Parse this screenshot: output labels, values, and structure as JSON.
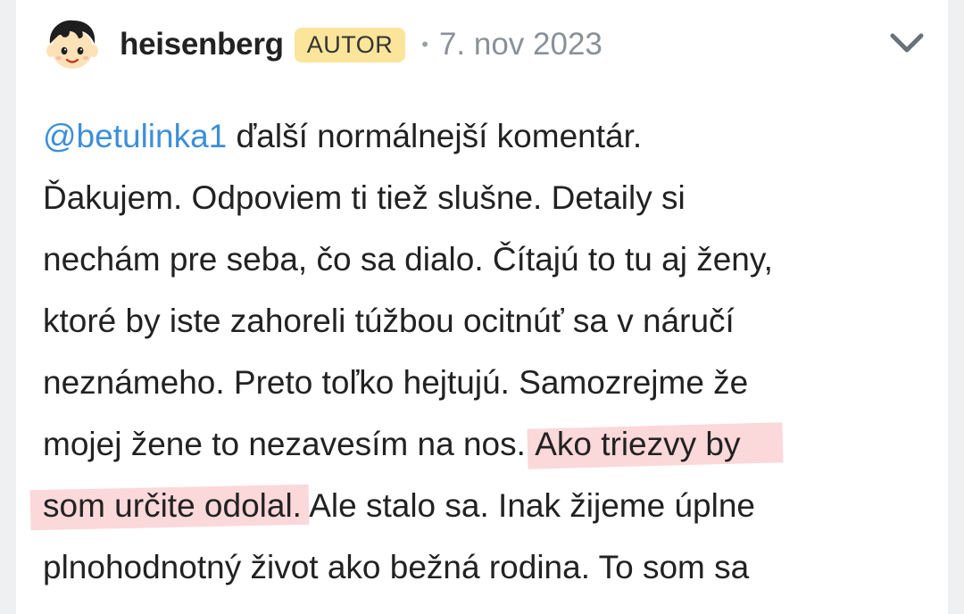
{
  "comment": {
    "author": {
      "name": "heisenberg",
      "badge": "AUTOR",
      "separator": "•",
      "date": "7. nov 2023",
      "avatar_icon": "cartoon-boy-avatar"
    },
    "menu_icon": "chevron-down-icon",
    "mention": "@betulinka1",
    "lines": {
      "l1_rest": " ďalší normálnejší komentár.",
      "l2": "Ďakujem. Odpoviem ti tiež slušne. Detaily si",
      "l3": "nechám pre seba, čo sa dialo. Čítajú to tu aj ženy,",
      "l4": "ktoré by iste zahoreli túžbou ocitnúť sa v náručí",
      "l5": "neznámeho. Preto toľko hejtujú. Samozrejme že",
      "l6_plain": "mojej žene to nezavesím na nos. ",
      "l6_highlight": "Ako triezvy by",
      "l7_highlight": "som určite odolal.",
      "l7_plain": " Ale stalo sa. Inak žijeme úplne",
      "l8": "plnohodnotný život ako bežná rodina. To som sa"
    },
    "highlight_color": "#f7a8ac",
    "mention_color": "#3d8fd8",
    "badge_color": "#fbe59a"
  }
}
